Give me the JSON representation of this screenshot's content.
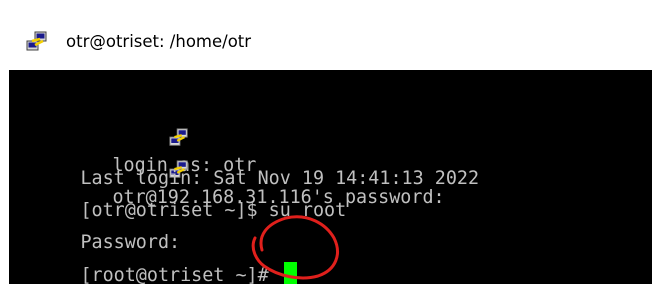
{
  "window": {
    "title": "otr@otriset: /home/otr",
    "title_icon": "putty-icon"
  },
  "terminal": {
    "background": "#000000",
    "foreground": "#c0c0c0",
    "cursor_color": "#00ff00",
    "lines": [
      {
        "icon": "putty-icon",
        "text": "login as: otr"
      },
      {
        "icon": "putty-icon",
        "text": "otr@192.168.31.116's password:"
      },
      {
        "text": "Last login: Sat Nov 19 14:41:13 2022"
      },
      {
        "text": "[otr@otriset ~]$ su root"
      },
      {
        "text": "Password:"
      },
      {
        "text": "[root@otriset ~]# "
      }
    ]
  },
  "annotation": {
    "color": "#e0201c",
    "shape": "hand-drawn-circle"
  }
}
